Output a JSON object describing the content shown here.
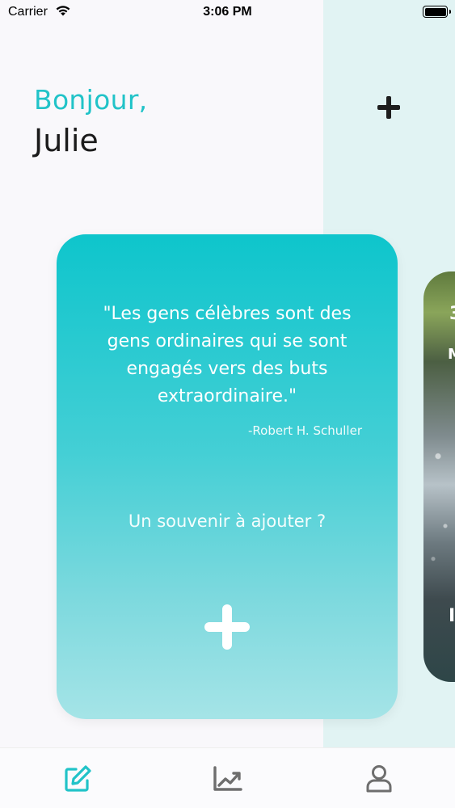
{
  "status_bar": {
    "carrier": "Carrier",
    "time": "3:06 PM",
    "wifi_icon": "wifi-icon",
    "battery_icon": "battery-icon",
    "battery_level": 1.0
  },
  "header": {
    "greeting": "Bonjour,",
    "name": "Julie",
    "add_icon": "plus-icon"
  },
  "card": {
    "quote": "\"Les gens célèbres sont des gens ordinaires qui se sont engagés vers des buts extraordinaire.\"",
    "author": "-Robert H. Schuller",
    "prompt": "Un souvenir à ajouter ?",
    "add_icon": "plus-icon"
  },
  "tab_bar": {
    "tabs": [
      {
        "icon": "edit-icon",
        "active": true
      },
      {
        "icon": "chart-icon",
        "active": false
      },
      {
        "icon": "user-icon",
        "active": false
      }
    ]
  },
  "colors": {
    "accent": "#21c3c8",
    "card_top": "#0ec5cc",
    "card_bottom": "#a5e4e7",
    "panel": "#e1f3f3",
    "inactive_icon": "#6e6e6e"
  }
}
